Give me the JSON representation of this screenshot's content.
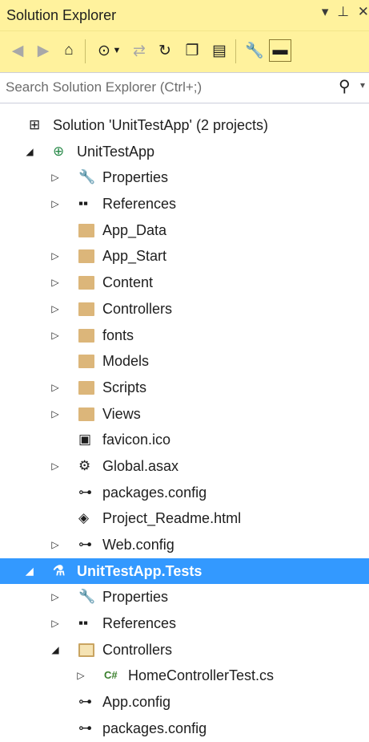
{
  "window": {
    "title": "Solution Explorer",
    "controls": [
      "▾",
      "⊥",
      "✕"
    ]
  },
  "toolbar": {
    "buttons": [
      "back-icon",
      "forward-icon",
      "home-icon",
      "pending-changes-icon",
      "sync-icon",
      "refresh-icon",
      "collapse-all-icon",
      "show-all-files-icon",
      "properties-icon",
      "preview-icon"
    ]
  },
  "search": {
    "placeholder": "Search Solution Explorer (Ctrl+;)",
    "value": ""
  },
  "tree": [
    {
      "label": "Solution 'UnitTestApp' (2 projects)",
      "icon": "solution-icon",
      "expander": "none"
    },
    {
      "label": "UnitTestApp",
      "icon": "web-project-icon",
      "expander": "expanded"
    },
    {
      "label": "Properties",
      "icon": "wrench-icon",
      "expander": "collapsed"
    },
    {
      "label": "References",
      "icon": "references-icon",
      "expander": "collapsed"
    },
    {
      "label": "App_Data",
      "icon": "folder-icon",
      "expander": "none"
    },
    {
      "label": "App_Start",
      "icon": "folder-icon",
      "expander": "collapsed"
    },
    {
      "label": "Content",
      "icon": "folder-icon",
      "expander": "collapsed"
    },
    {
      "label": "Controllers",
      "icon": "folder-icon",
      "expander": "collapsed"
    },
    {
      "label": "fonts",
      "icon": "folder-icon",
      "expander": "collapsed"
    },
    {
      "label": "Models",
      "icon": "folder-icon",
      "expander": "none"
    },
    {
      "label": "Scripts",
      "icon": "folder-icon",
      "expander": "collapsed"
    },
    {
      "label": "Views",
      "icon": "folder-icon",
      "expander": "collapsed"
    },
    {
      "label": "favicon.ico",
      "icon": "image-file-icon",
      "expander": "none"
    },
    {
      "label": "Global.asax",
      "icon": "asax-file-icon",
      "expander": "collapsed"
    },
    {
      "label": "packages.config",
      "icon": "config-file-icon",
      "expander": "none"
    },
    {
      "label": "Project_Readme.html",
      "icon": "html-file-icon",
      "expander": "none"
    },
    {
      "label": "Web.config",
      "icon": "config-file-icon",
      "expander": "collapsed"
    },
    {
      "label": "UnitTestApp.Tests",
      "icon": "test-project-icon",
      "expander": "expanded",
      "selected": true
    },
    {
      "label": "Properties",
      "icon": "wrench-icon",
      "expander": "collapsed"
    },
    {
      "label": "References",
      "icon": "references-icon",
      "expander": "collapsed"
    },
    {
      "label": "Controllers",
      "icon": "open-folder-icon",
      "expander": "expanded"
    },
    {
      "label": "HomeControllerTest.cs",
      "icon": "csharp-file-icon",
      "expander": "collapsed"
    },
    {
      "label": "App.config",
      "icon": "config-file-icon",
      "expander": "none"
    },
    {
      "label": "packages.config",
      "icon": "config-file-icon",
      "expander": "none"
    }
  ],
  "colors": {
    "titlebar": "#fff29d",
    "selection": "#3399ff",
    "folder": "#dcb67a"
  }
}
